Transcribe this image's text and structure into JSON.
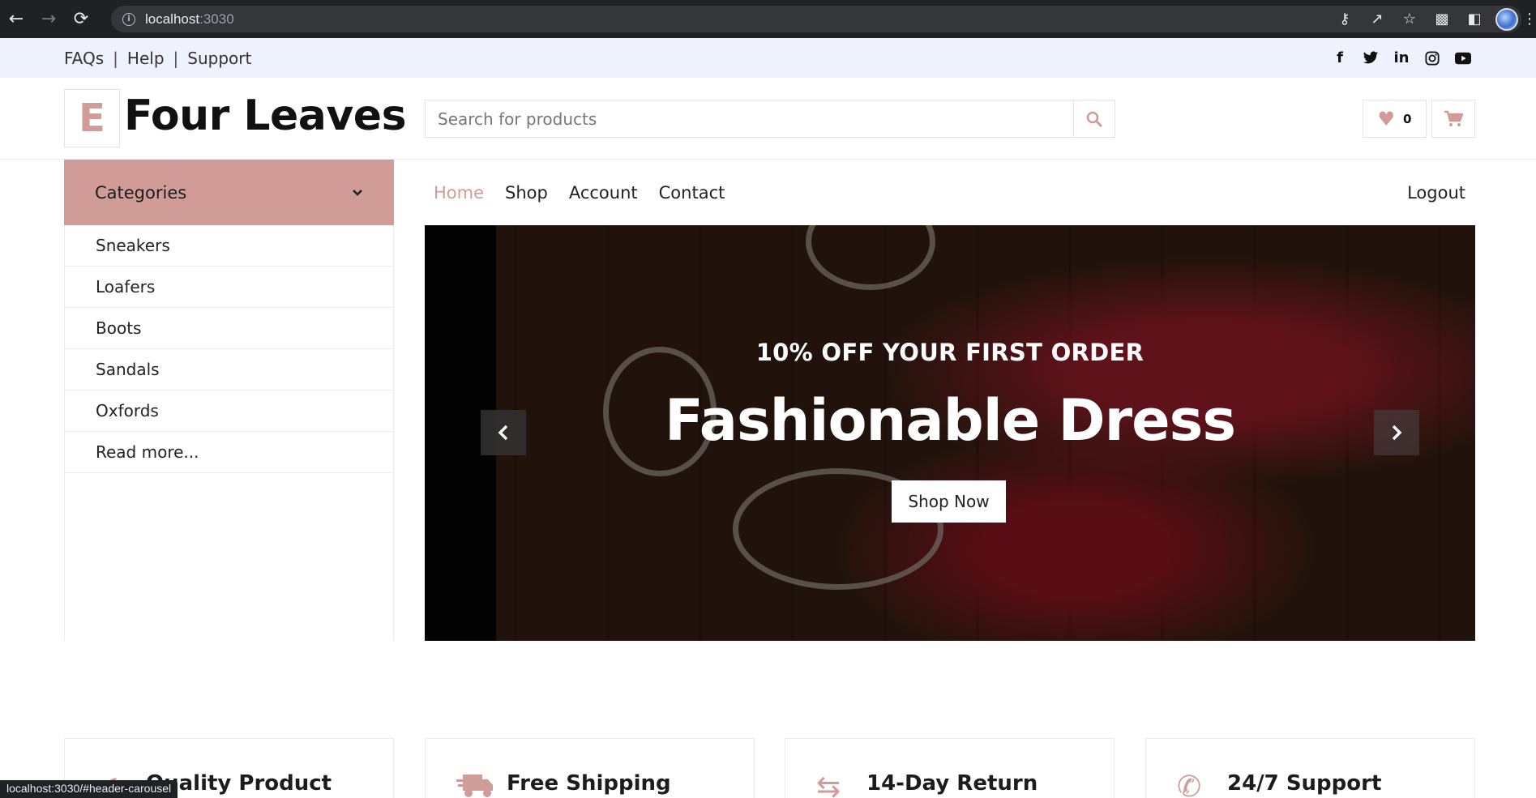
{
  "browser": {
    "url_host": "localhost",
    "url_port": ":3030",
    "status_url": "localhost:3030/#header-carousel"
  },
  "topbar": {
    "links": [
      "FAQs",
      "Help",
      "Support"
    ],
    "separator": "|",
    "social": [
      "facebook-icon",
      "twitter-icon",
      "linkedin-icon",
      "instagram-icon",
      "youtube-icon"
    ]
  },
  "header": {
    "logo_letter": "E",
    "logo_text": "Four Leaves",
    "search_placeholder": "Search for products",
    "wishlist_count": "0"
  },
  "sidebar": {
    "title": "Categories",
    "items": [
      "Sneakers",
      "Loafers",
      "Boots",
      "Sandals",
      "Oxfords",
      "Read more..."
    ]
  },
  "nav": {
    "items": [
      "Home",
      "Shop",
      "Account",
      "Contact"
    ],
    "active": "Home",
    "logout": "Logout"
  },
  "carousel": {
    "subtitle": "10% OFF YOUR FIRST ORDER",
    "title": "Fashionable Dress",
    "button": "Shop Now"
  },
  "features": [
    {
      "label": "Quality Product",
      "icon": "check-icon"
    },
    {
      "label": "Free Shipping",
      "icon": "truck-icon"
    },
    {
      "label": "14-Day Return",
      "icon": "exchange-icon"
    },
    {
      "label": "24/7 Support",
      "icon": "phone-icon"
    }
  ],
  "colors": {
    "accent": "#d19c97",
    "topbar_bg": "#eef2fd"
  }
}
